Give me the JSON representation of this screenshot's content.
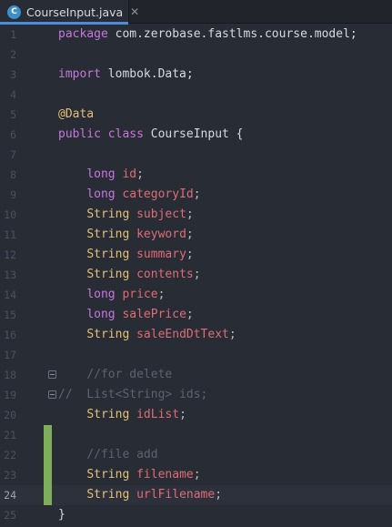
{
  "tab": {
    "icon_letter": "C",
    "title": "CourseInput.java",
    "close": "✕"
  },
  "colors": {
    "keyword": "#c678dd",
    "type": "#e5c07b",
    "field": "#e06c75",
    "comment": "#5c6370",
    "background": "#282c34",
    "accent": "#4f8bd6",
    "change_marker": "#7fae5a"
  },
  "lines": [
    {
      "n": "1",
      "t": [
        {
          "c": "kw",
          "s": "package"
        },
        {
          "c": "pk",
          "s": " com.zerobase.fastlms.course.model;"
        }
      ]
    },
    {
      "n": "2",
      "t": []
    },
    {
      "n": "3",
      "t": [
        {
          "c": "kw",
          "s": "import"
        },
        {
          "c": "pk",
          "s": " lombok.Data;"
        }
      ]
    },
    {
      "n": "4",
      "t": []
    },
    {
      "n": "5",
      "t": [
        {
          "c": "an",
          "s": "@Data"
        }
      ]
    },
    {
      "n": "6",
      "t": [
        {
          "c": "kw",
          "s": "public class"
        },
        {
          "c": "pk",
          "s": " CourseInput {"
        }
      ]
    },
    {
      "n": "7",
      "t": []
    },
    {
      "n": "8",
      "t": [
        {
          "c": "pl",
          "s": "    "
        },
        {
          "c": "kw",
          "s": "long"
        },
        {
          "c": "pl",
          "s": " "
        },
        {
          "c": "fd",
          "s": "id"
        },
        {
          "c": "pl",
          "s": ";"
        }
      ]
    },
    {
      "n": "9",
      "t": [
        {
          "c": "pl",
          "s": "    "
        },
        {
          "c": "kw",
          "s": "long"
        },
        {
          "c": "pl",
          "s": " "
        },
        {
          "c": "fd",
          "s": "categoryId"
        },
        {
          "c": "pl",
          "s": ";"
        }
      ]
    },
    {
      "n": "10",
      "t": [
        {
          "c": "pl",
          "s": "    "
        },
        {
          "c": "ty",
          "s": "String"
        },
        {
          "c": "pl",
          "s": " "
        },
        {
          "c": "fd",
          "s": "subject"
        },
        {
          "c": "pl",
          "s": ";"
        }
      ]
    },
    {
      "n": "11",
      "t": [
        {
          "c": "pl",
          "s": "    "
        },
        {
          "c": "ty",
          "s": "String"
        },
        {
          "c": "pl",
          "s": " "
        },
        {
          "c": "fd",
          "s": "keyword"
        },
        {
          "c": "pl",
          "s": ";"
        }
      ]
    },
    {
      "n": "12",
      "t": [
        {
          "c": "pl",
          "s": "    "
        },
        {
          "c": "ty",
          "s": "String"
        },
        {
          "c": "pl",
          "s": " "
        },
        {
          "c": "fd",
          "s": "summary"
        },
        {
          "c": "pl",
          "s": ";"
        }
      ]
    },
    {
      "n": "13",
      "t": [
        {
          "c": "pl",
          "s": "    "
        },
        {
          "c": "ty",
          "s": "String"
        },
        {
          "c": "pl",
          "s": " "
        },
        {
          "c": "fd",
          "s": "contents"
        },
        {
          "c": "pl",
          "s": ";"
        }
      ]
    },
    {
      "n": "14",
      "t": [
        {
          "c": "pl",
          "s": "    "
        },
        {
          "c": "kw",
          "s": "long"
        },
        {
          "c": "pl",
          "s": " "
        },
        {
          "c": "fd",
          "s": "price"
        },
        {
          "c": "pl",
          "s": ";"
        }
      ]
    },
    {
      "n": "15",
      "t": [
        {
          "c": "pl",
          "s": "    "
        },
        {
          "c": "kw",
          "s": "long"
        },
        {
          "c": "pl",
          "s": " "
        },
        {
          "c": "fd",
          "s": "salePrice"
        },
        {
          "c": "pl",
          "s": ";"
        }
      ]
    },
    {
      "n": "16",
      "t": [
        {
          "c": "pl",
          "s": "    "
        },
        {
          "c": "ty",
          "s": "String"
        },
        {
          "c": "pl",
          "s": " "
        },
        {
          "c": "fd",
          "s": "saleEndDtText"
        },
        {
          "c": "pl",
          "s": ";"
        }
      ]
    },
    {
      "n": "17",
      "t": []
    },
    {
      "n": "18",
      "t": [
        {
          "c": "pl",
          "s": "    "
        },
        {
          "c": "cm",
          "s": "//for delete"
        }
      ]
    },
    {
      "n": "19",
      "t": [
        {
          "c": "cm",
          "s": "//  List<String> ids;"
        }
      ]
    },
    {
      "n": "20",
      "t": [
        {
          "c": "pl",
          "s": "    "
        },
        {
          "c": "ty",
          "s": "String"
        },
        {
          "c": "pl",
          "s": " "
        },
        {
          "c": "fd",
          "s": "idList"
        },
        {
          "c": "pl",
          "s": ";"
        }
      ]
    },
    {
      "n": "21",
      "t": []
    },
    {
      "n": "22",
      "t": [
        {
          "c": "pl",
          "s": "    "
        },
        {
          "c": "cm",
          "s": "//file add"
        }
      ]
    },
    {
      "n": "23",
      "t": [
        {
          "c": "pl",
          "s": "    "
        },
        {
          "c": "ty",
          "s": "String"
        },
        {
          "c": "pl",
          "s": " "
        },
        {
          "c": "fd",
          "s": "filename"
        },
        {
          "c": "pl",
          "s": ";"
        }
      ]
    },
    {
      "n": "24",
      "t": [
        {
          "c": "pl",
          "s": "    "
        },
        {
          "c": "ty",
          "s": "String"
        },
        {
          "c": "pl",
          "s": " "
        },
        {
          "c": "fd",
          "s": "urlFilename"
        },
        {
          "c": "pl",
          "s": ";"
        }
      ]
    },
    {
      "n": "25",
      "t": [
        {
          "c": "pk",
          "s": "}"
        }
      ]
    }
  ],
  "current_line": "24",
  "fold_markers": [
    "18",
    "19"
  ],
  "changed_lines": [
    "21",
    "22",
    "23",
    "24"
  ]
}
